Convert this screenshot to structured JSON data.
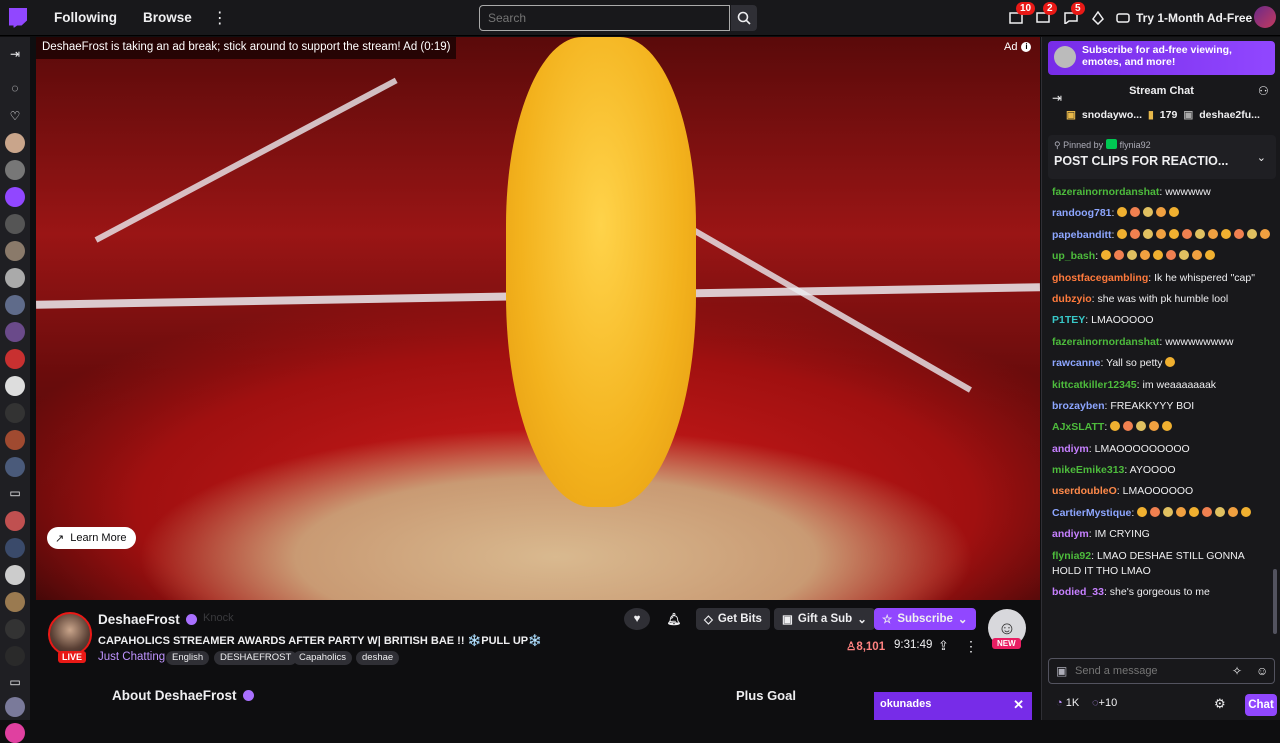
{
  "nav": {
    "following": "Following",
    "browse": "Browse",
    "search_placeholder": "Search",
    "notif_counts": [
      "10",
      "2",
      "5"
    ],
    "adfree_label": "Try 1-Month Ad-Free"
  },
  "video": {
    "ad_banner": "DeshaeFrost is taking an ad break; stick around to support the stream! Ad (0:19)",
    "ad_tag": "Ad",
    "learn_more": "Learn More"
  },
  "channel": {
    "name": "DeshaeFrost",
    "knock": "Knock",
    "title": "CAPAHOLICS STREAMER AWARDS AFTER PARTY W| BRITISH BAE !! ❄️PULL UP❄️",
    "live": "LIVE",
    "category": "Just Chatting",
    "tags": [
      "English",
      "DESHAEFROST",
      "Capaholics",
      "deshae"
    ],
    "get_bits": "Get Bits",
    "gift_sub": "Gift a Sub",
    "subscribe": "Subscribe",
    "viewers": "8,101",
    "uptime": "9:31:49",
    "new_badge": "NEW",
    "about": "About DeshaeFrost",
    "plus_goal": "Plus Goal",
    "okunades": "okunades"
  },
  "chat": {
    "promo": "Subscribe for ad-free viewing, emotes, and more!",
    "title": "Stream Chat",
    "gifter1": "snodaywo...",
    "gifter1_count": "179",
    "gifter2": "deshae2fu...",
    "pinned_by": "Pinned by",
    "pinned_user": "flynia92",
    "pinned_msg": "POST CLIPS FOR REACTIO...",
    "placeholder": "Send a message",
    "points": "1K",
    "bits": "+10",
    "chat_button": "Chat",
    "messages": [
      {
        "user": "fazerainornordanshat",
        "color": "#4dbb3c",
        "text": "wwwwww",
        "emotes": 0
      },
      {
        "user": "randoog781",
        "color": "#8da6ff",
        "text": "",
        "emotes": 5
      },
      {
        "user": "papebanditt",
        "color": "#8da6ff",
        "text": "",
        "emotes": 12
      },
      {
        "user": "up_bash",
        "color": "#4dbb3c",
        "text": "",
        "emotes": 9
      },
      {
        "user": "ghostfacegambling",
        "color": "#ff7a3c",
        "text": "Ik he whispered \"cap\"",
        "emotes": 0
      },
      {
        "user": "dubzyio",
        "color": "#ff7a3c",
        "text": "she was with pk humble lool",
        "emotes": 0
      },
      {
        "user": "P1TEY",
        "color": "#38c8c8",
        "text": "LMAOOOOO",
        "emotes": 0
      },
      {
        "user": "fazerainornordanshat",
        "color": "#4dbb3c",
        "text": "wwwwwwwww",
        "emotes": 0
      },
      {
        "user": "rawcanne",
        "color": "#8da6ff",
        "text": "Yall so petty",
        "emotes": 1
      },
      {
        "user": "kittcatkiller12345",
        "color": "#4dbb3c",
        "text": "im weaaaaaaak",
        "emotes": 0
      },
      {
        "user": "brozayben",
        "color": "#8da6ff",
        "text": "FREAKKYYY BOI",
        "emotes": 0
      },
      {
        "user": "AJxSLATT",
        "color": "#4dbb3c",
        "text": "",
        "emotes": 5
      },
      {
        "user": "andiym",
        "color": "#c680ff",
        "text": "LMAOOOOOOOOO",
        "emotes": 0
      },
      {
        "user": "mikeEmike313",
        "color": "#4dbb3c",
        "text": "AYOOOO",
        "emotes": 0
      },
      {
        "user": "userdoubleO",
        "color": "#ff8a4a",
        "text": "LMAOOOOOO",
        "emotes": 0
      },
      {
        "user": "CartierMystique",
        "color": "#8da6ff",
        "text": "",
        "emotes": 9
      },
      {
        "user": "andiym",
        "color": "#c680ff",
        "text": "IM CRYING",
        "emotes": 0
      },
      {
        "user": "flynia92",
        "color": "#4dbb3c",
        "text": "LMAO DESHAE STILL GONNA HOLD IT THO LMAO",
        "emotes": 0
      },
      {
        "user": "bodied_33",
        "color": "#c680ff",
        "text": "she's gorgeous to me",
        "emotes": 0
      }
    ]
  },
  "colors": {
    "accent": "#9147ff",
    "live": "#e91916",
    "bg": "#0e0e10"
  }
}
